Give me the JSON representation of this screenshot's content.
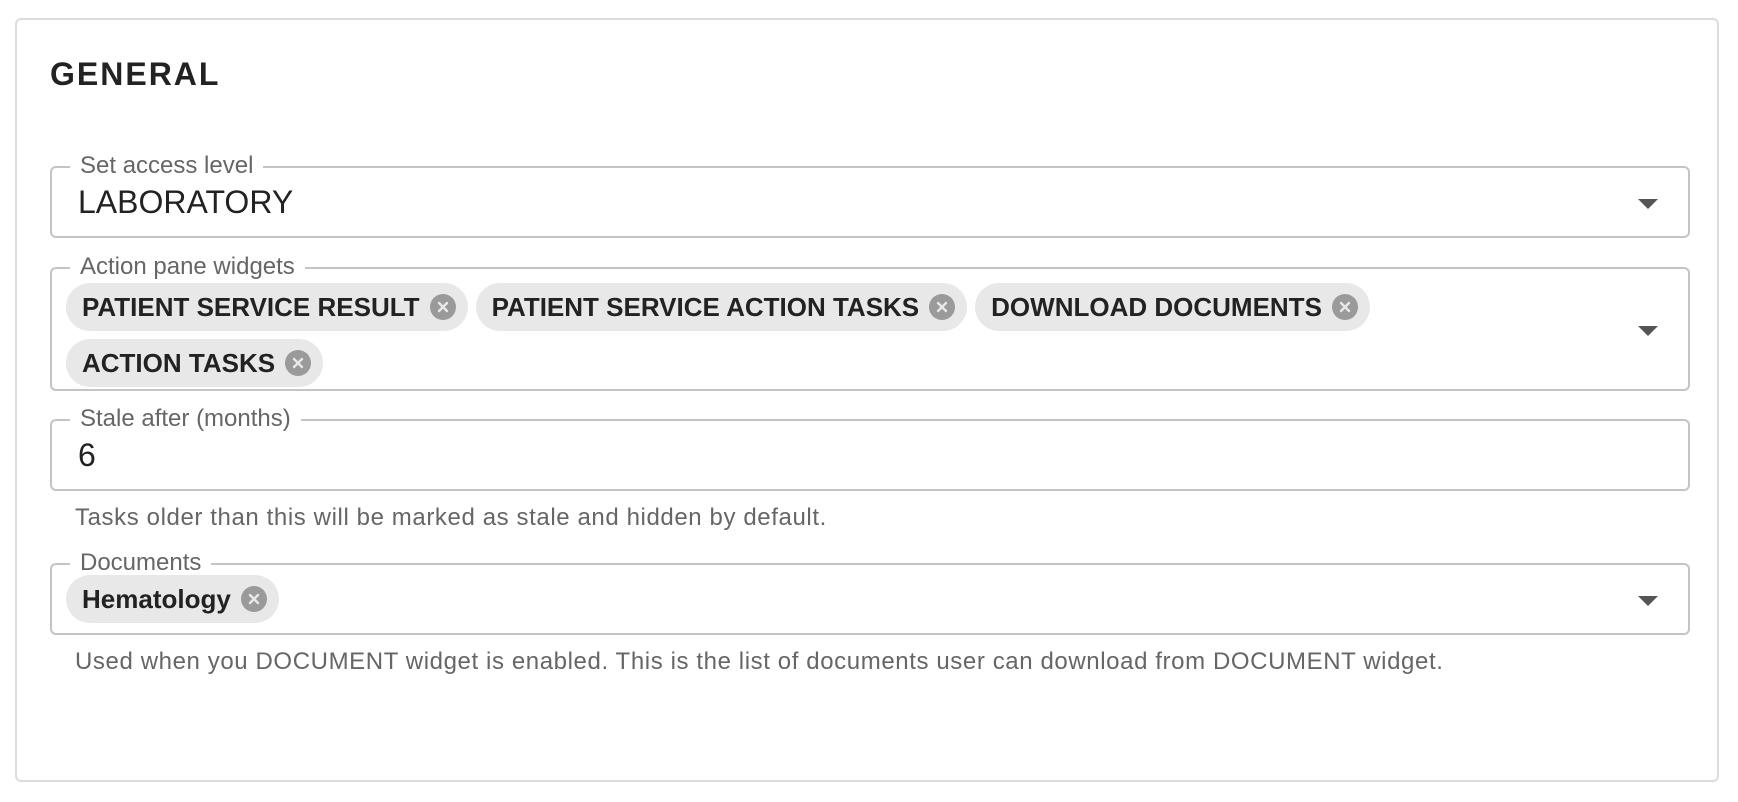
{
  "section": {
    "title": "GENERAL"
  },
  "access_level": {
    "label": "Set access level",
    "value": "LABORATORY",
    "dropdown_icon": "caret-down-icon"
  },
  "action_pane": {
    "label": "Action pane widgets",
    "chips": [
      {
        "label": "PATIENT SERVICE RESULT",
        "remove_icon": "cancel-circle-icon"
      },
      {
        "label": "PATIENT SERVICE ACTION TASKS",
        "remove_icon": "cancel-circle-icon"
      },
      {
        "label": "DOWNLOAD DOCUMENTS",
        "remove_icon": "cancel-circle-icon"
      },
      {
        "label": "ACTION TASKS",
        "remove_icon": "cancel-circle-icon"
      }
    ],
    "dropdown_icon": "caret-down-icon"
  },
  "stale_after": {
    "label": "Stale after (months)",
    "value": "6",
    "helper": "Tasks older than this will be marked as stale and hidden by default."
  },
  "documents": {
    "label": "Documents",
    "chips": [
      {
        "label": "Hematology",
        "remove_icon": "cancel-circle-icon"
      }
    ],
    "dropdown_icon": "caret-down-icon",
    "helper": "Used when you DOCUMENT widget is enabled. This is the list of documents user can download from DOCUMENT widget."
  },
  "colors": {
    "border": "#c4c4c4",
    "chip_bg": "#e8e8e8",
    "chip_close": "#9a9a9a",
    "text": "#222222",
    "muted": "#666666"
  }
}
